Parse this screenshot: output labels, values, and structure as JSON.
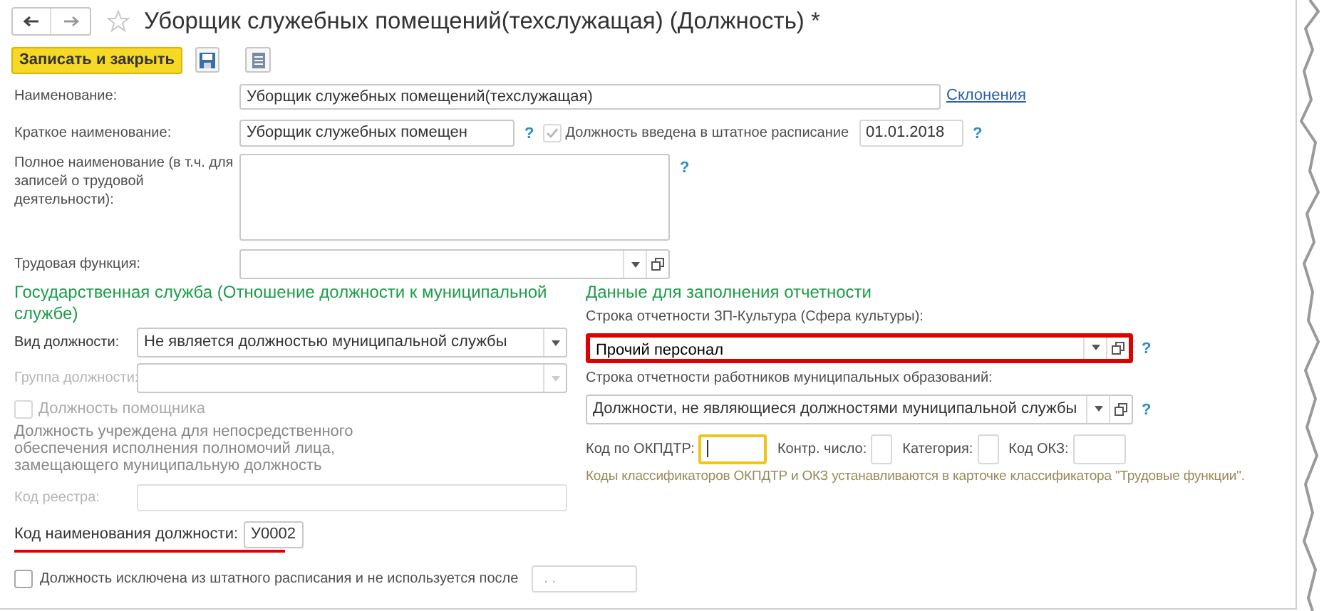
{
  "window": {
    "title": "Уборщик служебных помещений(техслужащая) (Должность) *",
    "favorite": false
  },
  "toolbar": {
    "save_close": "Записать и закрыть"
  },
  "fields": {
    "name": {
      "label": "Наименование:",
      "value": "Уборщик служебных помещений(техслужащая)",
      "link": "Склонения"
    },
    "short_name": {
      "label": "Краткое наименование:",
      "value": "Уборщик служебных помещен",
      "help": "?"
    },
    "in_schedule": {
      "label": "Должность введена в штатное расписание",
      "checked": true,
      "disabled": true,
      "date": "01.01.2018",
      "help": "?"
    },
    "full_name": {
      "label": "Полное наименование (в т.ч. для записей о трудовой деятельности):",
      "help": "?"
    },
    "labor_function": {
      "label": "Трудовая функция:"
    }
  },
  "civil_service": {
    "title": "Государственная служба (Отношение должности к муниципальной службе)",
    "position_type": {
      "label": "Вид должности:",
      "value": "Не является должностью муниципальной службы",
      "disabled": false
    },
    "position_group": {
      "label": "Группа должности:",
      "disabled": true
    },
    "assistant": {
      "label": "Должность помощника",
      "checked": false,
      "disabled": true
    },
    "note": "Должность учреждена для непосредственного обеспечения исполнения полномочий лица, замещающего муниципальную должность",
    "registry_code": {
      "label": "Код реестра:",
      "disabled": true
    },
    "name_code": {
      "label": "Код наименования должности:",
      "value": "У0002",
      "highlighted": true
    }
  },
  "reporting": {
    "title": "Данные для заполнения отчетности",
    "rows": [
      {
        "label": "Строка отчетности ЗП-Культура (Сфера культуры):",
        "value": "Прочий персонал",
        "help": "?",
        "highlighted": true
      },
      {
        "label": "Строка отчетности работников муниципальных образований:",
        "value": "Должности, не являющиеся должностями муниципальной службы",
        "help": "?",
        "highlighted": false
      }
    ],
    "codes": [
      {
        "label": "Код по ОКПДТР:",
        "focused": true
      },
      {
        "label": "Контр. число:",
        "focused": false
      },
      {
        "label": "Категория:",
        "focused": false
      },
      {
        "label": "Код ОКЗ:",
        "focused": false
      }
    ],
    "hint": "Коды классификаторов ОКПДТР и ОКЗ устанавливаются в карточке классификатора \"Трудовые функции\"."
  },
  "excluded": {
    "label": "Должность исключена из штатного расписания и не используется после",
    "checked": false,
    "date": ". ."
  }
}
